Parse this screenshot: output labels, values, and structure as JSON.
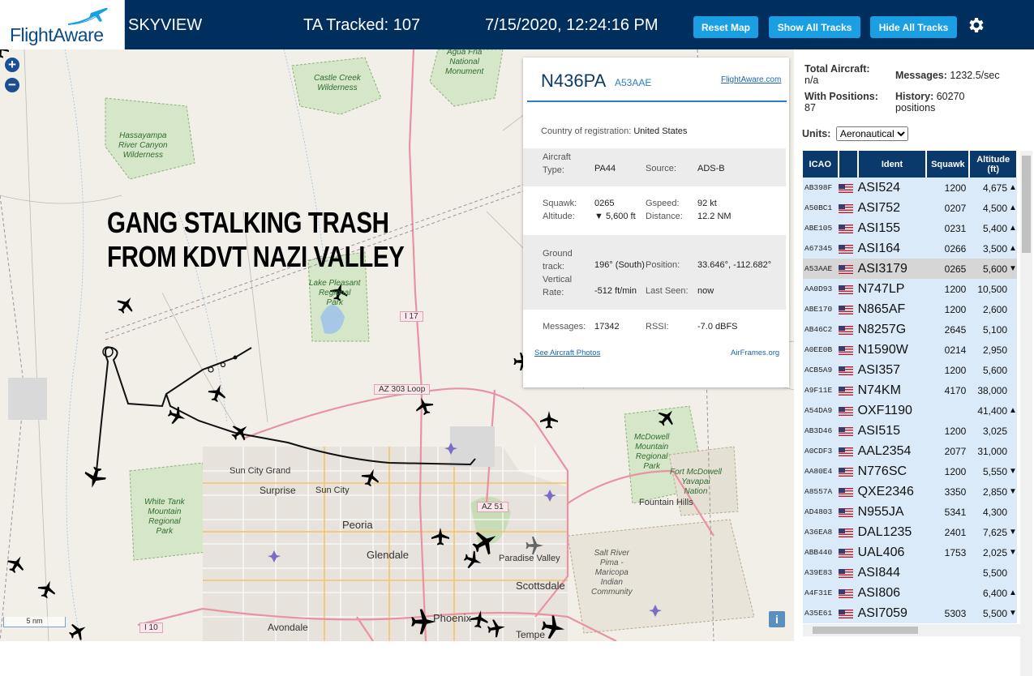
{
  "header": {
    "logo_text": "FlightAware",
    "app_name": "SKYVIEW",
    "tracked": "TA Tracked: 107",
    "datetime": "7/15/2020, 12:24:16 PM",
    "buttons": {
      "reset": "Reset Map",
      "show_all": "Show All Tracks",
      "hide_all": "Hide All Tracks"
    },
    "icons": {
      "settings": "gear-icon",
      "logo": "plane-icon"
    }
  },
  "map": {
    "overlay_lines": [
      "GANG STALKING TRASH",
      "FROM KDVT NAZI VALLEY"
    ],
    "zoom_in": "+",
    "zoom_out": "−",
    "info": "i",
    "scale": "5 nm",
    "labels": {
      "agua_fria": "Agua Fria\nNational\nMonument",
      "castle_creek": "Castle Creek\nWilderness",
      "hassayampa": "Hassayampa\nRiver Canyon\nWilderness",
      "lake_pleasant": "Lake Pleasant\nRegional\nPark",
      "mcdowell": "McDowell\nMountain\nRegional\nPark",
      "fort_mcdowell": "Fort McDowell\nYavapai\nNation",
      "white_tank": "White Tank\nMountain\nRegional\nPark",
      "salt_river": "Salt River\nPima -\nMaricopa\nIndian\nCommunity",
      "sun_city_grand": "Sun City Grand",
      "surprise": "Surprise",
      "sun_city": "Sun City",
      "peoria": "Peoria",
      "glendale": "Glendale",
      "fountain_hills": "Fountain Hills",
      "paradise_valley": "Paradise Valley",
      "scottsdale": "Scottsdale",
      "community": "Community",
      "avondale": "Avondale",
      "phoenix": "Phoenix",
      "tempe": "Tempe",
      "i17": "I 17",
      "az303": "AZ 303 Loop",
      "az51": "AZ 51",
      "i10": "I 10"
    }
  },
  "popup": {
    "registration": "N436PA",
    "hex": "A53AAE",
    "fa_link": "FlightAware.com",
    "country_label": "Country of registration:",
    "country": "United States",
    "aircraft_type_label": "Aircraft\nType:",
    "aircraft_type": "PA44",
    "source_label": "Source:",
    "source": "ADS-B",
    "squawk_label": "Squawk:",
    "squawk": "0265",
    "altitude_label": "Altitude:",
    "altitude": "▼ 5,600 ft",
    "gspeed_label": "Gspeed:",
    "gspeed": "92 kt",
    "distance_label": "Distance:",
    "distance": "12.2 NM",
    "ground_track_label": "Ground\ntrack:",
    "ground_track": "196° (South)",
    "position_label": "Position:",
    "position": "33.646°, -112.682°",
    "vertical_rate_label": "Vertical\nRate:",
    "vertical_rate": "-512 ft/min",
    "last_seen_label": "Last Seen:",
    "last_seen": "now",
    "messages_label": "Messages:",
    "messages": "17342",
    "rssi_label": "RSSI:",
    "rssi": "-7.0 dBFS",
    "photos_link": "See Aircraft Photos",
    "airframes_link": "AirFrames.org"
  },
  "panel": {
    "total_aircraft_label": "Total Aircraft:",
    "total_aircraft": "n/a",
    "messages_label": "Messages:",
    "messages": "1232.5/sec",
    "with_positions_label": "With Positions:",
    "with_positions": "87",
    "history_label": "History:",
    "history": "60270\npositions",
    "units_label": "Units:",
    "units_value": "Aeronautical",
    "columns": [
      "ICAO",
      "",
      "Ident",
      "Squawk",
      "Altitude\n(ft)"
    ],
    "rows": [
      {
        "icao": "AB398F",
        "ident": "ASI524",
        "squawk": "1200",
        "alt": "4,675",
        "dir": "▲"
      },
      {
        "icao": "A50BC1",
        "ident": "ASI752",
        "squawk": "0207",
        "alt": "4,500",
        "dir": "▲"
      },
      {
        "icao": "ABE105",
        "ident": "ASI155",
        "squawk": "0231",
        "alt": "5,400",
        "dir": "▲"
      },
      {
        "icao": "A67345",
        "ident": "ASI164",
        "squawk": "0266",
        "alt": "3,500",
        "dir": "▲"
      },
      {
        "icao": "A53AAE",
        "ident": "ASI3179",
        "squawk": "0265",
        "alt": "5,600",
        "dir": "▼"
      },
      {
        "icao": "AA0D93",
        "ident": "N747LP",
        "squawk": "1200",
        "alt": "10,500",
        "dir": ""
      },
      {
        "icao": "ABE170",
        "ident": "N865AF",
        "squawk": "1200",
        "alt": "2,600",
        "dir": ""
      },
      {
        "icao": "AB46C2",
        "ident": "N8257G",
        "squawk": "2645",
        "alt": "5,100",
        "dir": ""
      },
      {
        "icao": "A0EE0B",
        "ident": "N1590W",
        "squawk": "0214",
        "alt": "2,950",
        "dir": ""
      },
      {
        "icao": "ACB5A9",
        "ident": "ASI357",
        "squawk": "1200",
        "alt": "5,600",
        "dir": ""
      },
      {
        "icao": "A9F11E",
        "ident": "N74KM",
        "squawk": "4170",
        "alt": "38,000",
        "dir": ""
      },
      {
        "icao": "A54DA9",
        "ident": "OXF1190",
        "squawk": "",
        "alt": "41,400",
        "dir": "▲"
      },
      {
        "icao": "AB3D46",
        "ident": "ASI515",
        "squawk": "1200",
        "alt": "3,025",
        "dir": ""
      },
      {
        "icao": "A0CDF3",
        "ident": "AAL2354",
        "squawk": "2077",
        "alt": "31,000",
        "dir": ""
      },
      {
        "icao": "AA80E4",
        "ident": "N776SC",
        "squawk": "1200",
        "alt": "5,550",
        "dir": "▼"
      },
      {
        "icao": "A8557A",
        "ident": "QXE2346",
        "squawk": "3350",
        "alt": "2,850",
        "dir": "▼"
      },
      {
        "icao": "AD4803",
        "ident": "N955JA",
        "squawk": "5341",
        "alt": "4,300",
        "dir": ""
      },
      {
        "icao": "A36EA8",
        "ident": "DAL1235",
        "squawk": "2401",
        "alt": "7,625",
        "dir": "▼"
      },
      {
        "icao": "ABB440",
        "ident": "UAL406",
        "squawk": "1753",
        "alt": "2,025",
        "dir": "▼"
      },
      {
        "icao": "A39E83",
        "ident": "ASI844",
        "squawk": "",
        "alt": "5,500",
        "dir": ""
      },
      {
        "icao": "A4F31E",
        "ident": "ASI806",
        "squawk": "",
        "alt": "6,400",
        "dir": "▲"
      },
      {
        "icao": "A35E61",
        "ident": "ASI7059",
        "squawk": "5303",
        "alt": "5,500",
        "dir": "▼"
      }
    ],
    "selected_index": 4
  }
}
